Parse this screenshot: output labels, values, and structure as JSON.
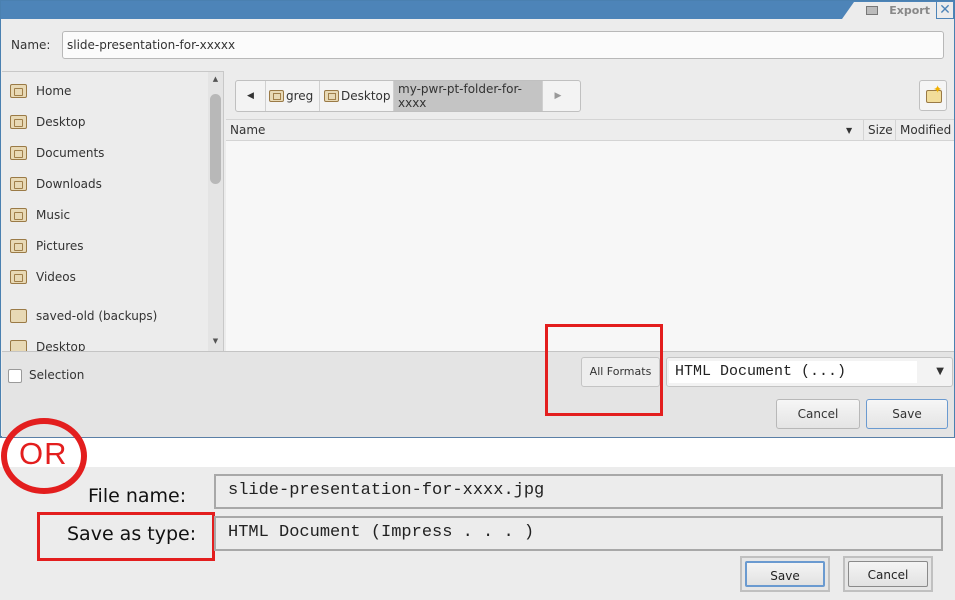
{
  "dialog": {
    "title": "Export",
    "close_glyph": "✕",
    "name_label": "Name:",
    "name_value": "slide-presentation-for-xxxxx",
    "places": [
      {
        "label": "Home",
        "icon": "home-folder-icon"
      },
      {
        "label": "Desktop",
        "icon": "desktop-folder-icon"
      },
      {
        "label": "Documents",
        "icon": "documents-folder-icon"
      },
      {
        "label": "Downloads",
        "icon": "downloads-folder-icon"
      },
      {
        "label": "Music",
        "icon": "music-folder-icon"
      },
      {
        "label": "Pictures",
        "icon": "pictures-folder-icon"
      },
      {
        "label": "Videos",
        "icon": "videos-folder-icon"
      },
      {
        "label": "saved-old (backups)",
        "icon": "folder-icon"
      },
      {
        "label": "Desktop",
        "icon": "folder-icon"
      }
    ],
    "breadcrumb": [
      "greg",
      "Desktop",
      "my-pwr-pt-folder-for-xxxx"
    ],
    "columns": {
      "name": "Name",
      "size": "Size",
      "modified": "Modified"
    },
    "selection_label": "Selection",
    "formats_button": "All Formats",
    "file_type": "HTML Document (...)",
    "cancel_label": "Cancel",
    "save_label": "Save"
  },
  "annotation": {
    "or_text": "OR",
    "highlight_color": "#e31e1e"
  },
  "windows_dialog": {
    "file_name_label": "File name:",
    "file_name_value": "slide-presentation-for-xxxx.jpg",
    "save_type_label": "Save as type:",
    "save_type_value": "HTML Document (Impress . . . )",
    "save_label": "Save",
    "cancel_label": "Cancel"
  },
  "colors": {
    "titlebar": "#4d84b8",
    "dialog_bg": "#ececec",
    "accent_border": "#6a9ad0"
  }
}
